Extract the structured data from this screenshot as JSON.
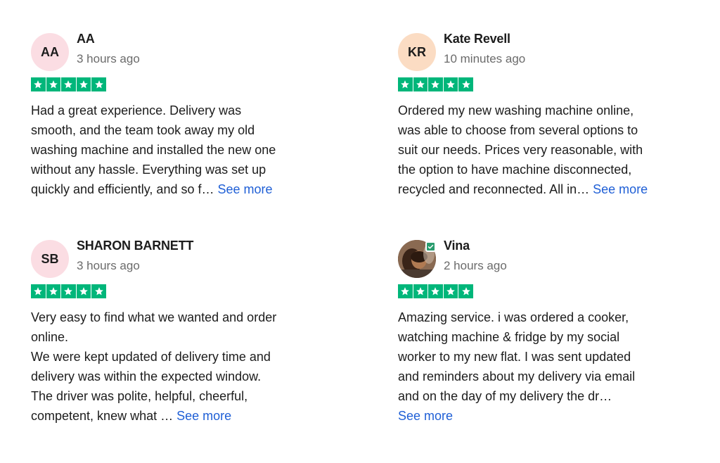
{
  "reviews": [
    {
      "initials": "AA",
      "name": "AA",
      "time": "3 hours ago",
      "rating": 5,
      "text": "Had a great experience. Delivery was\nsmooth, and the team took away my old\nwashing machine and installed the new one\nwithout any hassle. Everything was set up\nquickly and efficiently, and so f… ",
      "more": "See more"
    },
    {
      "initials": "KR",
      "name": "Kate Revell",
      "time": "10 minutes ago",
      "rating": 5,
      "text": "Ordered my new washing machine online,\nwas able to choose from several options to\nsuit our needs. Prices very reasonable, with\nthe option to have machine disconnected,\nrecycled and reconnected. All in… ",
      "more": "See more"
    },
    {
      "initials": "SB",
      "name": "SHARON BARNETT",
      "time": "3 hours ago",
      "rating": 5,
      "text": "Very easy to find what we wanted and order\nonline.\nWe were kept updated of delivery time and\ndelivery was within the expected window.\nThe driver was polite, helpful, cheerful,\ncompetent, knew what … ",
      "more": "See more"
    },
    {
      "initials": "",
      "name": "Vina",
      "time": "2 hours ago",
      "rating": 5,
      "verified": true,
      "text": "Amazing service. i was ordered a cooker,\nwatching machine & fridge by my social\nworker to my new flat. I was sent updated\nand reminders about my delivery via email\nand on the day of my delivery the dr…\n",
      "more": "See more"
    }
  ],
  "colors": {
    "star": "#00b67a",
    "link": "#1f5fd6",
    "avatar_pink": "#fbdde3",
    "avatar_peach": "#fbdcc3",
    "verified": "#2a9c6e"
  },
  "icons": {
    "star": "star-icon",
    "verified": "verified-check-icon"
  }
}
